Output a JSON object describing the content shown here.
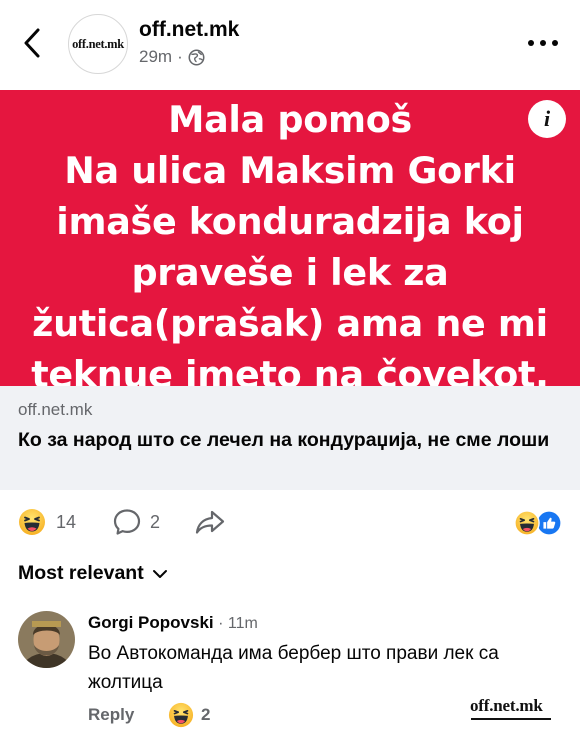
{
  "header": {
    "page_name": "off.net.mk",
    "avatar_logo_text": "off.net.mk",
    "time": "29m",
    "separator": "·",
    "icons": {
      "back": "chevron-left-icon",
      "privacy": "globe-icon",
      "more": "more-horizontal-icon"
    }
  },
  "post": {
    "image_lines": [
      "Mala pomoš",
      "Na ulica Maksim Gorki",
      "imaše konduradzija koj",
      "praveše i lek za",
      "žutica(prašak) ama ne mi",
      "teknue imeto na čovekot."
    ],
    "image_background": "#e5163f",
    "info_icon_label": "i",
    "link_domain": "off.net.mk",
    "link_title": "Ко за народ што се лечел на кондураџија, не сме лоши"
  },
  "reactions": {
    "haha_count": "14",
    "comment_count": "2",
    "icons": {
      "haha": "haha-emoji-icon",
      "comment": "comment-bubble-icon",
      "share": "share-arrow-icon",
      "like": "like-thumb-icon"
    },
    "like_color": "#1877f2"
  },
  "sort": {
    "label": "Most relevant",
    "icon": "chevron-down-icon"
  },
  "comment": {
    "author": "Gorgi Popovski",
    "separator": " · ",
    "time": "11m",
    "text": "Во Автокоманда има бербер што прави лек са жолтица",
    "reply_label": "Reply",
    "reaction_count": "2"
  },
  "watermark": "off.net.mk"
}
